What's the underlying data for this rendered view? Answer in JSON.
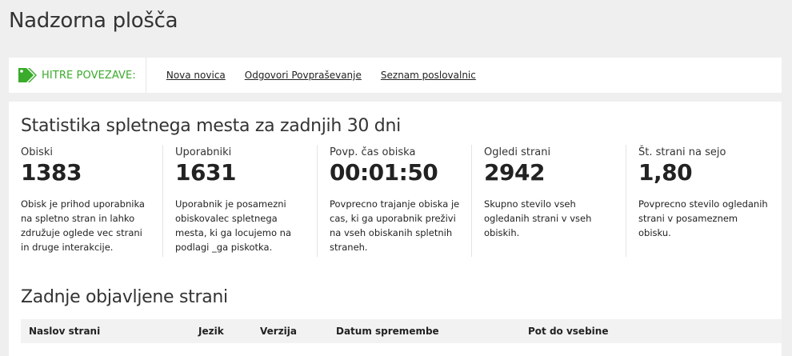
{
  "page": {
    "title": "Nadzorna plošča"
  },
  "quicklinks": {
    "label": "HITRE POVEZAVE:",
    "links": [
      "Nova novica",
      "Odgovori Povpraševanje",
      "Seznam poslovalnic"
    ]
  },
  "stats": {
    "title": "Statistika spletnega mesta za zadnjih 30 dni",
    "items": [
      {
        "label": "Obiski",
        "value": "1383",
        "desc": "Obisk je prihod uporabnika na spletno stran in lahko združuje oglede vec strani in druge interakcije."
      },
      {
        "label": "Uporabniki",
        "value": "1631",
        "desc": "Uporabnik je posamezni obiskovalec spletnega mesta, ki ga locujemo na podlagi _ga piskotka."
      },
      {
        "label": "Povp. čas obiska",
        "value": "00:01:50",
        "desc": "Povprecno trajanje obiska je cas, ki ga uporabnik preživi na vseh obiskanih spletnih straneh."
      },
      {
        "label": "Ogledi strani",
        "value": "2942",
        "desc": "Skupno stevilo vseh ogledanih strani v vseh obiskih."
      },
      {
        "label": "Št. strani na sejo",
        "value": "1,80",
        "desc": "Povprecno stevilo ogledanih strani v posameznem obisku."
      }
    ]
  },
  "recent": {
    "title": "Zadnje objavljene strani",
    "columns": [
      "Naslov strani",
      "Jezik",
      "Verzija",
      "Datum spremembe",
      "Pot do vsebine"
    ]
  },
  "colors": {
    "accent": "#3aab2b",
    "background": "#efefef",
    "card": "#ffffff"
  },
  "icons": {
    "quicklinks": "tag-icon"
  }
}
